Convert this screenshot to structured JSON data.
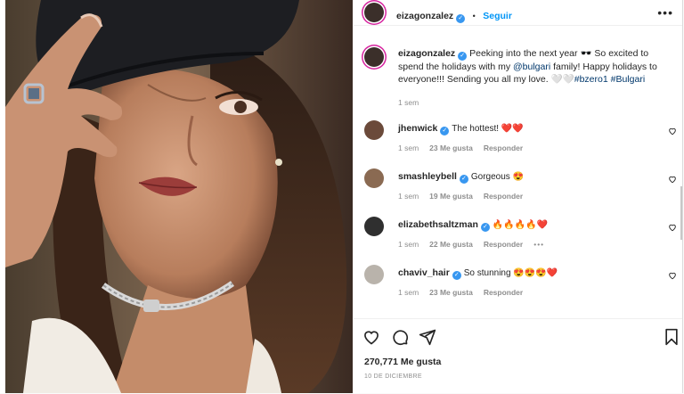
{
  "post": {
    "author": "eizagonzalez",
    "follow_label": "Seguir",
    "more_label": "•••",
    "caption_text": "Peeking into the next year 🕶️ So excited to spend the holidays with my ",
    "caption_mention": "@bulgari",
    "caption_text2": " family! Happy holidays to everyone!!! Sending you all my love. 🤍🤍",
    "caption_tag1": "#bzero1",
    "caption_tag2": "#Bulgari",
    "caption_time": "1 sem"
  },
  "comments": [
    {
      "user": "jhenwick",
      "verified": true,
      "text": "The hottest! ❤️❤️",
      "time": "1 sem",
      "likes": "23 Me gusta",
      "reply": "Responder"
    },
    {
      "user": "smashleybell",
      "verified": true,
      "text": "Gorgeous 😍",
      "time": "1 sem",
      "likes": "19 Me gusta",
      "reply": "Responder"
    },
    {
      "user": "elizabethsaltzman",
      "verified": true,
      "text": "🔥🔥🔥🔥❤️",
      "time": "1 sem",
      "likes": "22 Me gusta",
      "reply": "Responder",
      "more": "•••"
    },
    {
      "user": "chaviv_hair",
      "verified": true,
      "text": "So stunning 😍😍😍❤️",
      "time": "1 sem",
      "likes": "23 Me gusta",
      "reply": "Responder"
    }
  ],
  "actions": {
    "likes_count": "270,771 Me gusta",
    "date": "10 DE DICIEMBRE"
  },
  "icons": [
    "heart-icon",
    "comment-icon",
    "share-icon",
    "bookmark-icon",
    "verified-icon",
    "more-icon"
  ],
  "colors": {
    "verified": "#3897f0",
    "follow": "#0095f6",
    "link": "#00376b",
    "heart": "#ed4956"
  }
}
